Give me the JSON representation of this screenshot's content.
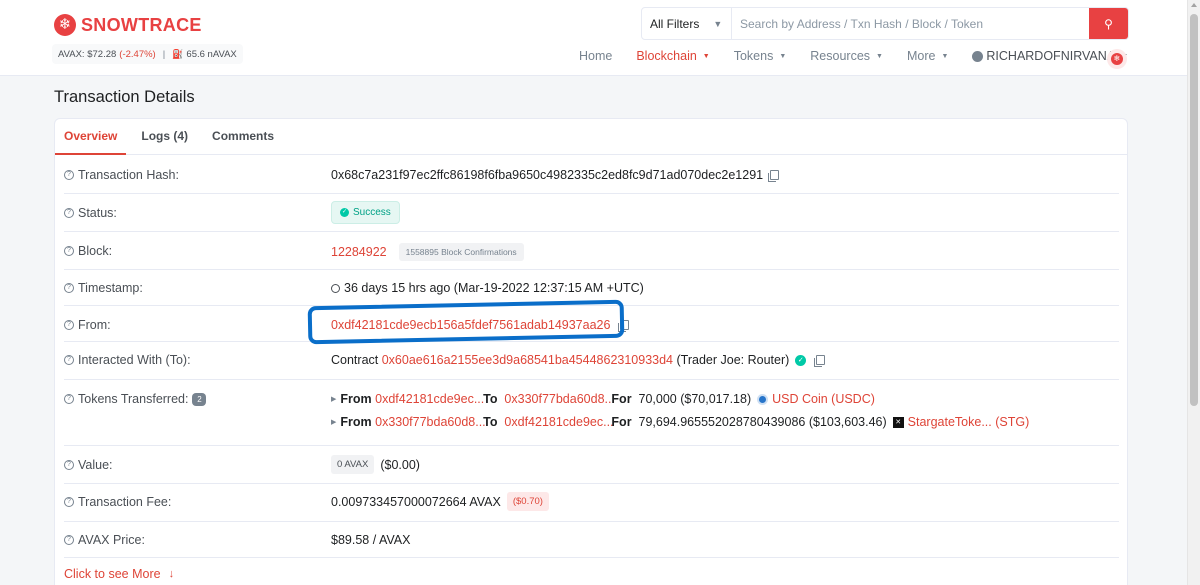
{
  "brand": {
    "name": "SNOWTRACE",
    "logo_glyph": "❄"
  },
  "ticker": {
    "price": "AVAX: $72.28",
    "change": "(-2.47%)",
    "separator": "|",
    "gas": "65.6 nAVAX"
  },
  "search": {
    "filter": "All Filters",
    "placeholder": "Search by Address / Txn Hash / Block / Token"
  },
  "nav": {
    "home": "Home",
    "blockchain": "Blockchain",
    "tokens": "Tokens",
    "resources": "Resources",
    "more": "More",
    "user": "RICHARDOFNIRVANA"
  },
  "page": {
    "title": "Transaction Details"
  },
  "tabs": {
    "overview": "Overview",
    "logs": "Logs (4)",
    "comments": "Comments"
  },
  "details": {
    "tx_hash": {
      "label": "Transaction Hash:",
      "value": "0x68c7a231f97ec2ffc86198f6fba9650c4982335c2ed8fc9d71ad070dec2e1291"
    },
    "status": {
      "label": "Status:",
      "value": "Success"
    },
    "block": {
      "label": "Block:",
      "value": "12284922",
      "confirmations": "1558895 Block Confirmations"
    },
    "timestamp": {
      "label": "Timestamp:",
      "value": "36 days 15 hrs ago (Mar-19-2022 12:37:15 AM +UTC)"
    },
    "from": {
      "label": "From:",
      "value": "0xdf42181cde9ecb156a5fdef7561adab14937aa26"
    },
    "interacted": {
      "label": "Interacted With (To):",
      "prefix": "Contract",
      "address": "0x60ae616a2155ee3d9a68541ba4544862310933d4",
      "name": "(Trader Joe: Router)"
    },
    "tokens": {
      "label": "Tokens Transferred:",
      "count": "2",
      "transfers": [
        {
          "from_label": "From",
          "from": "0xdf42181cde9ec...",
          "to_label": "To",
          "to": "0x330f77bda60d8...",
          "for_label": "For",
          "amount": "70,000 ($70,017.18)",
          "token": "USD Coin (USDC)"
        },
        {
          "from_label": "From",
          "from": "0x330f77bda60d8...",
          "to_label": "To",
          "to": "0xdf42181cde9ec...",
          "for_label": "For",
          "amount": "79,694.965552028780439086 ($103,603.46)",
          "token": "StargateToke... (STG)"
        }
      ]
    },
    "value": {
      "label": "Value:",
      "badge": "0 AVAX",
      "usd": "($0.00)"
    },
    "fee": {
      "label": "Transaction Fee:",
      "value": "0.009733457000072664 AVAX",
      "usd": "($0.70)"
    },
    "avax_price": {
      "label": "AVAX Price:",
      "value": "$89.58 / AVAX"
    }
  },
  "more_link": "Click to see More",
  "colors": {
    "brand": "#e84142",
    "link": "#de4437",
    "success": "#00c9a7",
    "highlight": "#0a6ec9"
  }
}
